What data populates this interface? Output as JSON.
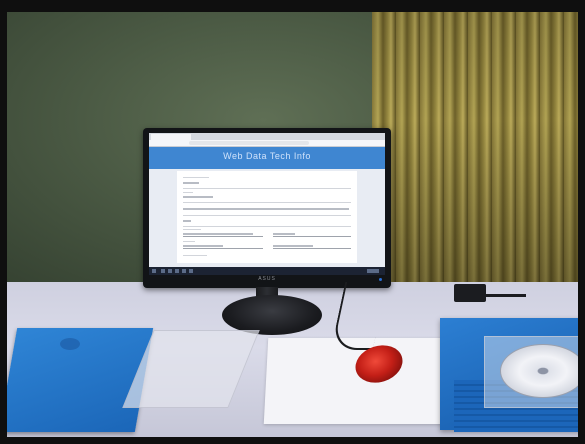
{
  "screen": {
    "app_title": "Web Data Tech Info"
  },
  "monitor": {
    "brand": "ASUS"
  },
  "colors": {
    "app_header": "#3f86d1",
    "mouse": "#c41f17",
    "folders": "#1f6ec4",
    "curtain": "#9e8e42"
  }
}
